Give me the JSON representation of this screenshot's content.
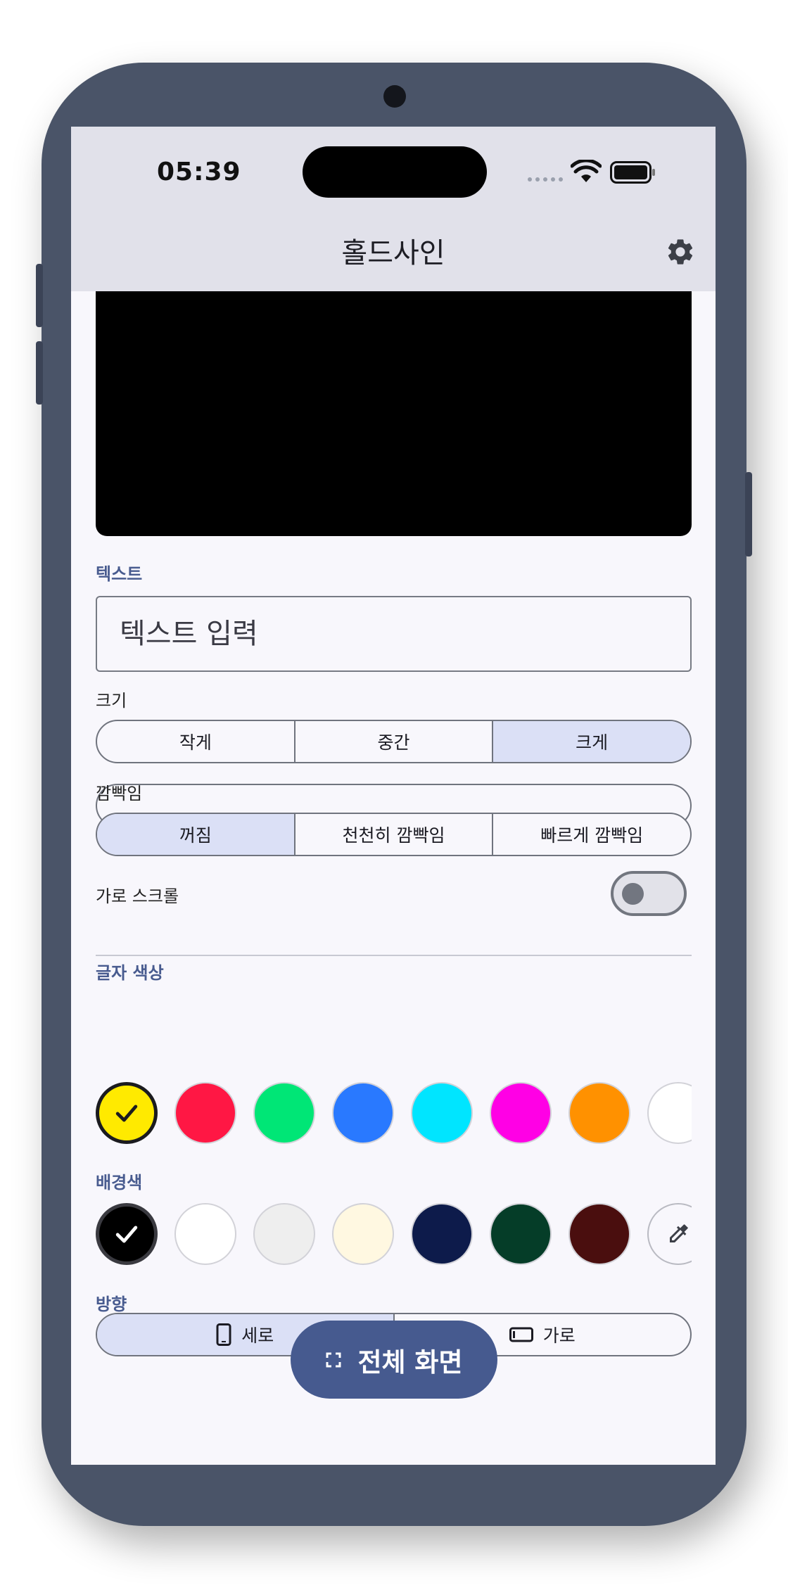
{
  "status_bar": {
    "time": "05:39"
  },
  "app": {
    "title": "홀드사인"
  },
  "icons": {
    "settings": "gear-icon",
    "wifi": "wifi-icon",
    "battery": "battery-icon",
    "check": "check-icon",
    "eyedropper": "eyedropper-icon",
    "portrait": "portrait-phone-icon",
    "landscape": "landscape-phone-icon",
    "fullscreen": "fullscreen-icon"
  },
  "text_section": {
    "label": "텍스트",
    "placeholder": "텍스트 입력",
    "value": ""
  },
  "size_section": {
    "label": "크기",
    "options": [
      "작게",
      "중간",
      "크게"
    ],
    "selected": "크게"
  },
  "blink_section": {
    "label": "깜빡임",
    "options": [
      "꺼짐",
      "천천히 깜빡임",
      "빠르게 깜빡임"
    ],
    "selected": "꺼짐"
  },
  "scroll_section": {
    "label": "가로 스크롤",
    "enabled": false
  },
  "text_color_section": {
    "label": "글자 색상",
    "colors": [
      "#FFEA00",
      "#FF1744",
      "#00E676",
      "#2979FF",
      "#00E5FF",
      "#FF00E5",
      "#FF9100",
      "#FFFFFF"
    ],
    "selected": "#FFEA00"
  },
  "bg_color_section": {
    "label": "배경색",
    "colors": [
      "#000000",
      "#FFFFFF",
      "#EEEEEE",
      "#FFF8E1",
      "#0D1B4B",
      "#053D28",
      "#4A0E0E"
    ],
    "selected": "#000000"
  },
  "orientation_section": {
    "label": "방향",
    "options": [
      "세로",
      "가로"
    ],
    "selected": "세로"
  },
  "fullscreen_button": {
    "label": "전체 화면"
  },
  "colors": {
    "accent": "#465A8F",
    "selected_segment": "#DBE0F6",
    "phone_frame": "#4A5468"
  }
}
